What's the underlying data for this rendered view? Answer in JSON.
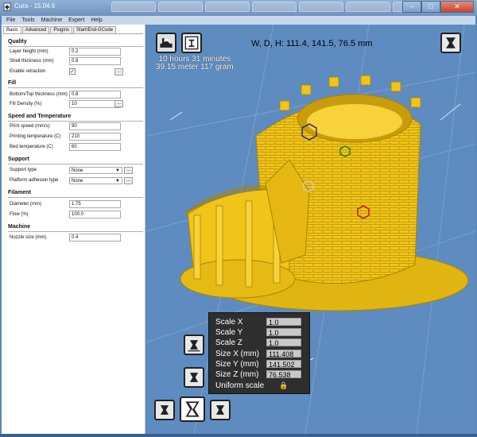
{
  "window": {
    "title": "Cura - 15.04.6",
    "minimize": "–",
    "maximize": "□",
    "close": "✕"
  },
  "menu": [
    "File",
    "Tools",
    "Machine",
    "Expert",
    "Help"
  ],
  "tabs": [
    "Basic",
    "Advanced",
    "Plugins",
    "Start/End-GCode"
  ],
  "sections": {
    "quality": "Quality",
    "fill": "Fill",
    "speed": "Speed and Temperature",
    "support": "Support",
    "filament": "Filament",
    "machine": "Machine"
  },
  "fields": {
    "layer_height": {
      "label": "Layer height (mm)",
      "value": "0.2"
    },
    "shell_thickness": {
      "label": "Shell thickness (mm)",
      "value": "0.8"
    },
    "enable_retraction": {
      "label": "Enable retraction",
      "value": "✓"
    },
    "bottom_top_thickness": {
      "label": "Bottom/Top thickness (mm)",
      "value": "0.8"
    },
    "fill_density": {
      "label": "Fill Density (%)",
      "value": "10"
    },
    "print_speed": {
      "label": "Print speed (mm/s)",
      "value": "90"
    },
    "printing_temperature": {
      "label": "Printing temperature (C)",
      "value": "210"
    },
    "bed_temperature": {
      "label": "Bed temperature (C)",
      "value": "60"
    },
    "support_type": {
      "label": "Support type",
      "value": "None"
    },
    "platform_adhesion": {
      "label": "Platform adhesion type",
      "value": "None"
    },
    "diameter": {
      "label": "Diameter (mm)",
      "value": "1.75"
    },
    "flow": {
      "label": "Flow (%)",
      "value": "100.0"
    },
    "nozzle_size": {
      "label": "Nozzle size (mm)",
      "value": "0.4"
    }
  },
  "more_button": "...",
  "viewport": {
    "print_time": "10 hours 31 minutes",
    "print_material": "39.15 meter 117 gram",
    "dimensions": "W, D, H: 111.4, 141.5, 76.5 mm"
  },
  "scale": {
    "scale_x": {
      "label": "Scale X",
      "value": "1.0"
    },
    "scale_y": {
      "label": "Scale Y",
      "value": "1.0"
    },
    "scale_z": {
      "label": "Scale Z",
      "value": "1.0"
    },
    "size_x": {
      "label": "Size X (mm)",
      "value": "111.408"
    },
    "size_y": {
      "label": "Size Y (mm)",
      "value": "141.502"
    },
    "size_z": {
      "label": "Size Z (mm)",
      "value": "76.538"
    },
    "uniform": {
      "label": "Uniform scale",
      "icon": "lock-icon"
    }
  },
  "colors": {
    "model": "#f0c419",
    "viewport_bg": "#5e8cc0",
    "panel_bg": "#2e2e2e"
  }
}
